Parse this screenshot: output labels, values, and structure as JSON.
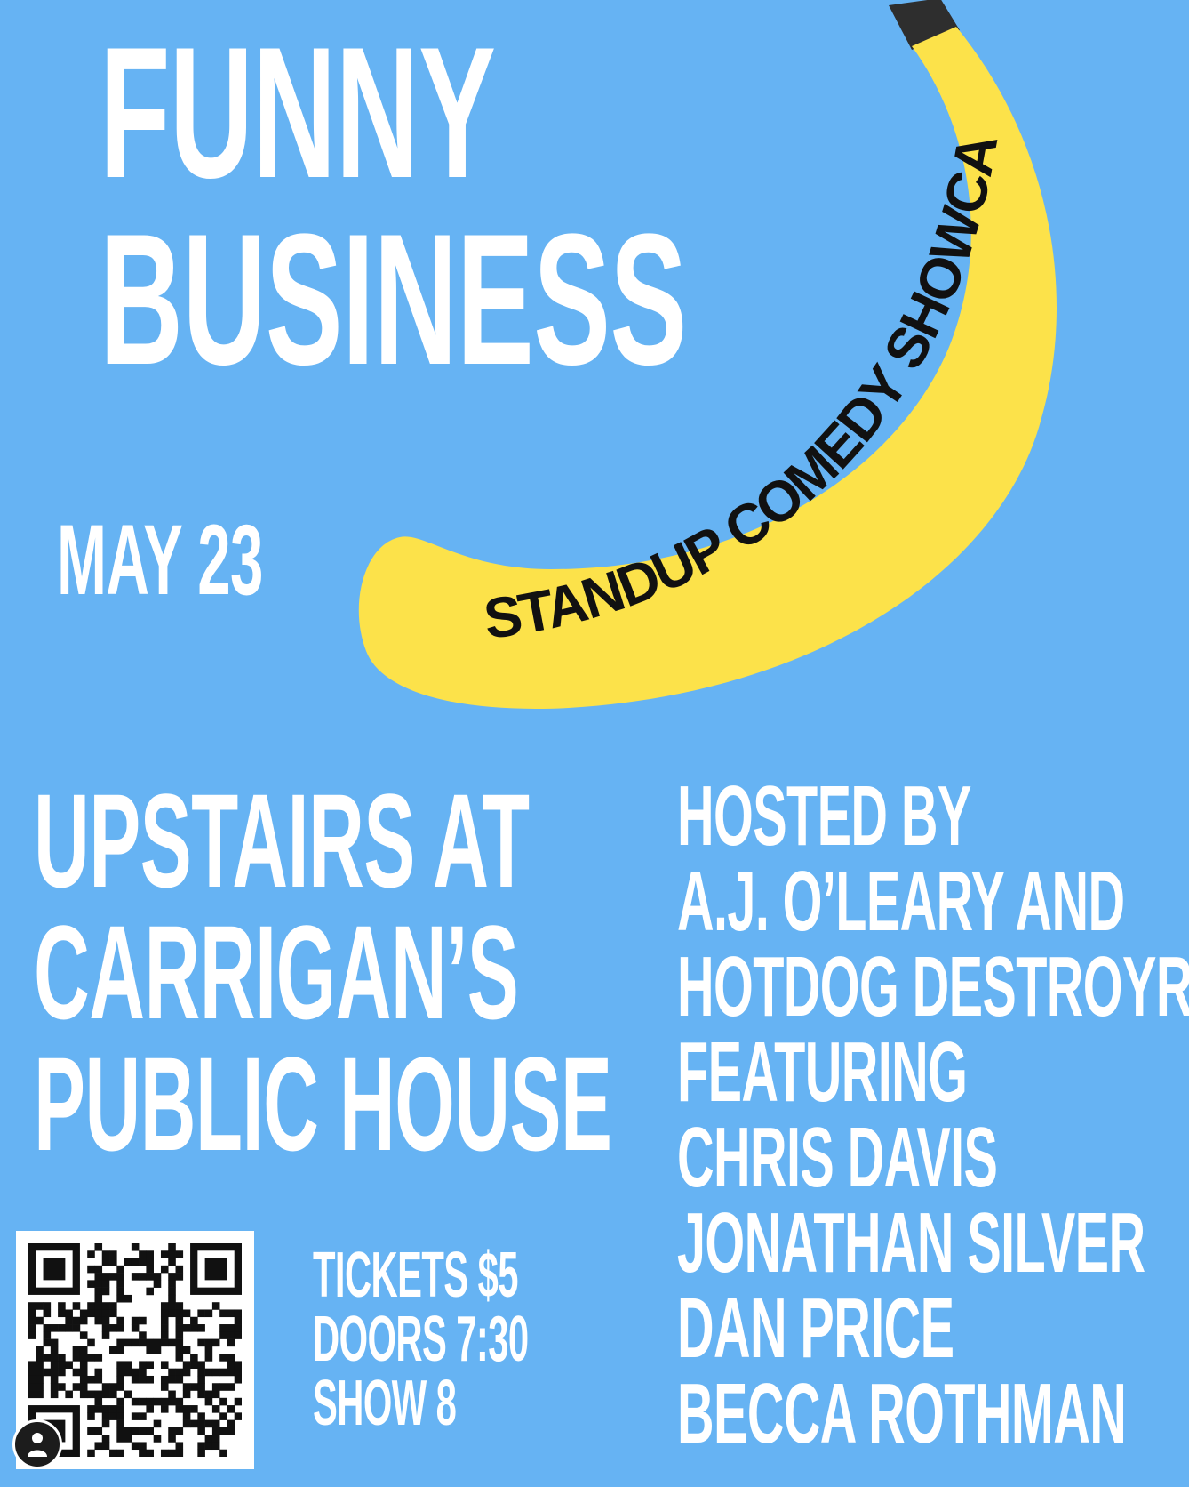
{
  "title": {
    "line1": "FUNNY",
    "line2": "BUSINESS"
  },
  "banana_label": "STANDUP COMEDY SHOWCASE",
  "date": "MAY 23",
  "venue": {
    "line1": "UPSTAIRS AT",
    "line2": "CARRIGAN’S",
    "line3": "PUBLIC HOUSE"
  },
  "lineup": [
    "HOSTED BY",
    "A.J. O’LEARY AND",
    "HOTDOG DESTROYR",
    "FEATURING",
    "CHRIS DAVIS",
    "JONATHAN SILVER",
    "DAN PRICE",
    "BECCA ROTHMAN"
  ],
  "info": {
    "tickets": "TICKETS $5",
    "doors": "DOORS 7:30",
    "show": "SHOW 8"
  },
  "icons": {
    "qr": "qr-code",
    "avatar": "profile-avatar-icon",
    "banana": "banana-illustration"
  },
  "colors": {
    "background": "#66b3f3",
    "banana": "#fce24a",
    "banana_stem": "#2e2e2e",
    "text": "#ffffff",
    "banana_text": "#111111"
  }
}
